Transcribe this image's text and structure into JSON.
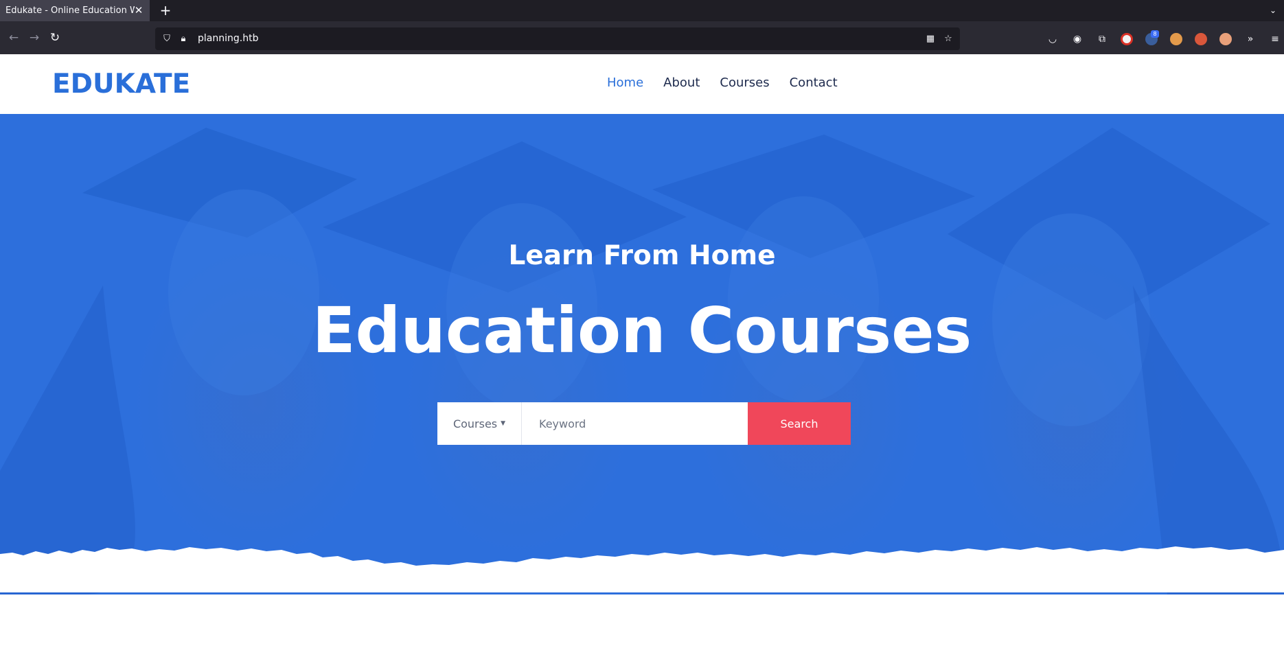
{
  "browser": {
    "tab_title": "Edukate - Online Education W",
    "tab_close": "✕",
    "new_tab": "+",
    "url": "planning.htb",
    "extension_badge": "8"
  },
  "site": {
    "logo": "EDUKATE",
    "menu": [
      {
        "label": "Home",
        "active": true
      },
      {
        "label": "About",
        "active": false
      },
      {
        "label": "Courses",
        "active": false
      },
      {
        "label": "Contact",
        "active": false
      }
    ]
  },
  "hero": {
    "subtitle": "Learn From Home",
    "title": "Education Courses",
    "search": {
      "category": "Courses",
      "placeholder": "Keyword",
      "button": "Search"
    }
  },
  "colors": {
    "brand_blue": "#2a6fd9",
    "hero_blue": "#2d6fdc",
    "search_button": "#f0475a"
  }
}
